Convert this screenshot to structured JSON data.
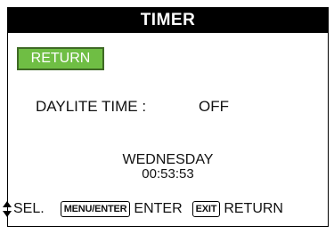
{
  "header": {
    "title": "TIMER"
  },
  "buttons": {
    "return_label": "RETURN"
  },
  "setting": {
    "label": "DAYLITE TIME :",
    "value": "OFF"
  },
  "clock": {
    "day": "WEDNESDAY",
    "time": "00:53:53"
  },
  "footer": {
    "select_icon": "up-down-arrows-icon",
    "select_label": "SEL.",
    "enter_key": "MENU/ENTER",
    "enter_label": "ENTER",
    "exit_key": "EXIT",
    "exit_label": "RETURN"
  },
  "colors": {
    "title_bg": "#000000",
    "return_bg": "#6fbe44",
    "return_border": "#3f6a25"
  }
}
